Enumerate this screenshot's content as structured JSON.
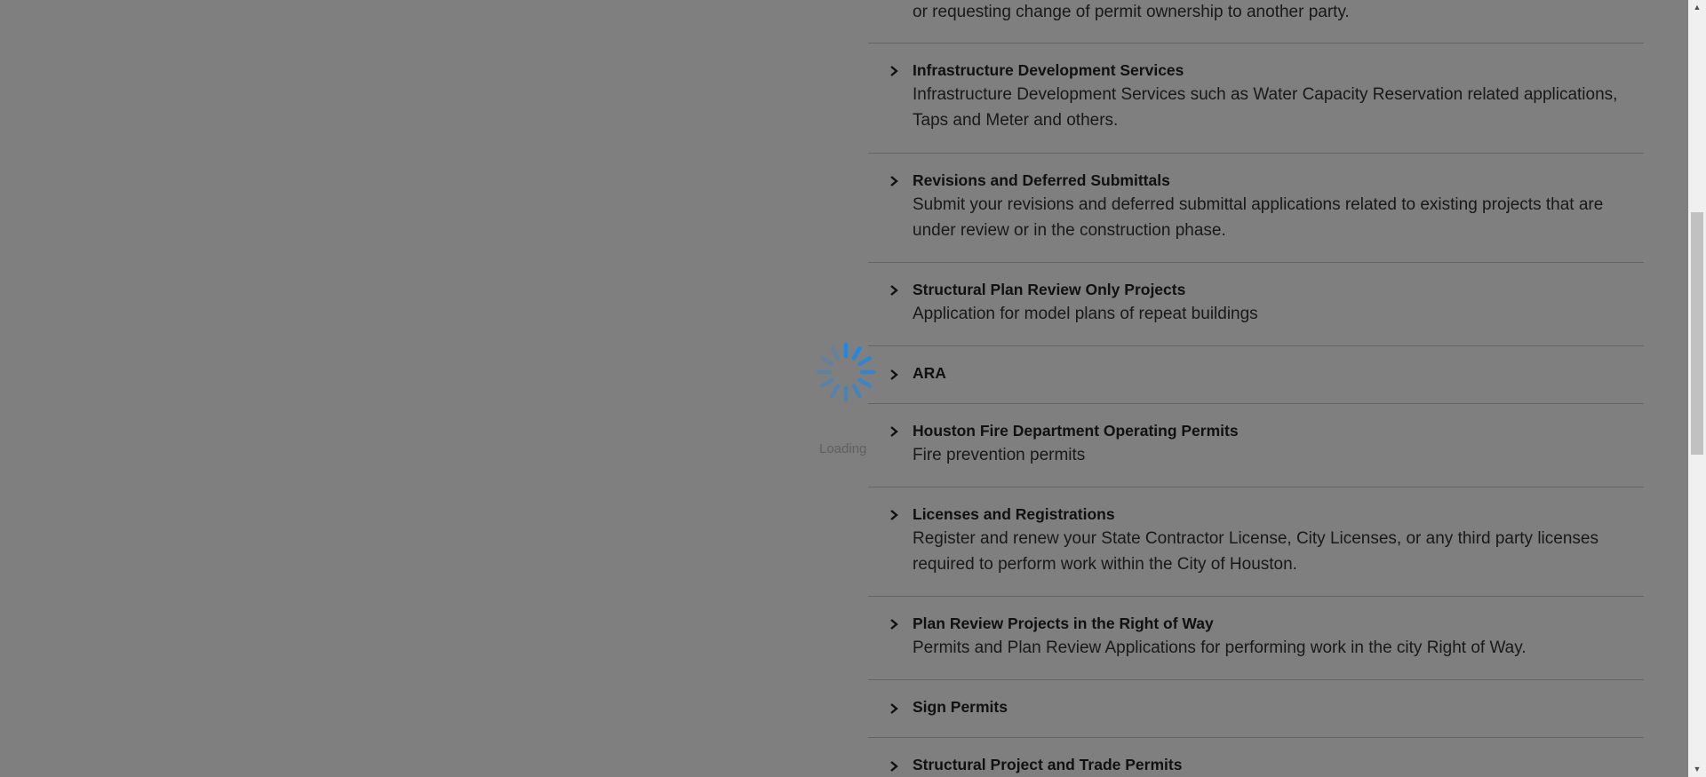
{
  "top_row": {
    "description_tail": "or requesting change of permit ownership to another party."
  },
  "categories": [
    {
      "title": "Infrastructure Development Services",
      "description": "Infrastructure Development Services such as Water Capacity Reservation related applications, Taps and Meter and others."
    },
    {
      "title": "Revisions and Deferred Submittals",
      "description": "Submit your revisions and deferred submittal applications related to existing projects that are under review or in the construction phase."
    },
    {
      "title": "Structural Plan Review Only Projects",
      "description": "Application for model plans of repeat buildings"
    },
    {
      "title": "ARA",
      "description": ""
    },
    {
      "title": "Houston Fire Department Operating Permits",
      "description": "Fire prevention permits"
    },
    {
      "title": "Licenses and Registrations",
      "description": "Register and renew your State Contractor License, City Licenses, or any third party licenses required to perform work within the City of Houston."
    },
    {
      "title": "Plan Review Projects in the Right of Way",
      "description": "Permits and Plan Review Applications for performing work in the city Right of Way."
    },
    {
      "title": "Sign Permits",
      "description": ""
    },
    {
      "title": "Structural Project and Trade Permits",
      "description": ""
    }
  ],
  "loading": {
    "text": "Loading"
  },
  "icons": {
    "expand": "chevron-right-icon",
    "spinner": "loading-spinner-icon"
  },
  "colors": {
    "spinner": "#1e88e5",
    "overlay": "#000000"
  }
}
